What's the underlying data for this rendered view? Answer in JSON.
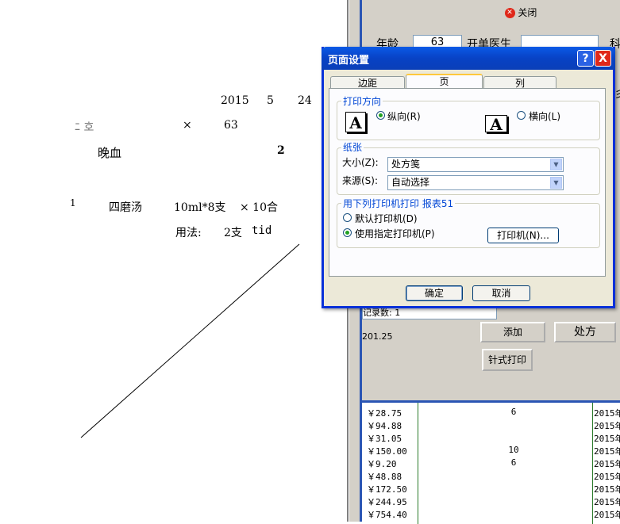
{
  "preview": {
    "date_year": "2015",
    "date_month": "5",
    "date_day": "24",
    "patient_name": "ﾆ 호",
    "gender": "×",
    "age": "63",
    "diagnosis": "晚血",
    "count": "2",
    "item_no": "1",
    "drug_name": "四磨汤",
    "spec": "10ml*8支",
    "qty": "× 10合",
    "usage_label": "用法:",
    "usage_dose": "2支",
    "usage_freq": "tid"
  },
  "form": {
    "close_label": "关闭",
    "age_label": "年龄",
    "age_value": "63",
    "doctor_label": "开单医生",
    "partial_label": "科",
    "partial_right1": "彡",
    "record_count": "记录数: 1",
    "amount": "201.25",
    "add_label": "添加",
    "rx_label": "处方",
    "print_label": "针式打印"
  },
  "grid": {
    "rows": [
      {
        "price": "￥28.75",
        "qty": "6",
        "date": "2015年"
      },
      {
        "price": "￥94.88",
        "qty": "",
        "date": "2015年"
      },
      {
        "price": "￥31.05",
        "qty": "",
        "date": "2015年"
      },
      {
        "price": "￥150.00",
        "qty": "10",
        "date": "2015年"
      },
      {
        "price": "￥9.20",
        "qty": "6",
        "date": "2015年"
      },
      {
        "price": "￥48.88",
        "qty": "",
        "date": "2015年"
      },
      {
        "price": "￥172.50",
        "qty": "",
        "date": "2015年"
      },
      {
        "price": "￥244.95",
        "qty": "",
        "date": "2015年"
      },
      {
        "price": "￥754.40",
        "qty": "",
        "date": "2015年"
      }
    ]
  },
  "dialog": {
    "title": "页面设置",
    "help": "?",
    "close": "X",
    "tabs": [
      "边距",
      "页",
      "列"
    ],
    "orientation_group": "打印方向",
    "portrait": "纵向(R)",
    "landscape": "横向(L)",
    "paper_group": "纸张",
    "size_label": "大小(Z):",
    "size_value": "处方笺",
    "source_label": "来源(S):",
    "source_value": "自动选择",
    "printer_group": "用下列打印机打印 报表51",
    "default_printer": "默认打印机(D)",
    "specific_printer": "使用指定打印机(P)",
    "printer_button": "打印机(N)...",
    "ok": "确定",
    "cancel": "取消",
    "icon_letter": "A"
  },
  "colors": {
    "xp_title_blue": "#0842c5",
    "dialog_face": "#ece9d8",
    "group_label": "#0046d5",
    "radio_dot": "#21a121",
    "close_red": "#e0281a"
  }
}
